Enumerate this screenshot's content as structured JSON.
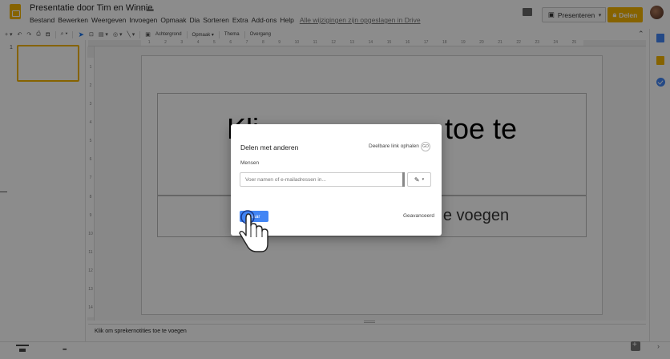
{
  "header": {
    "title": "Presentatie door Tim en Winnie",
    "menu": [
      "Bestand",
      "Bewerken",
      "Weergeven",
      "Invoegen",
      "Opmaak",
      "Dia",
      "Sorteren",
      "Extra",
      "Add-ons",
      "Help"
    ],
    "saved_status": "Alle wijzigingen zijn opgeslagen in Drive",
    "present_label": "Presenteren",
    "share_label": "Delen"
  },
  "toolbar": {
    "background_label": "Achtergrond",
    "layout_label": "Opmaak ▾",
    "theme_label": "Thema",
    "transition_label": "Overgang"
  },
  "ruler": {
    "top": [
      "1",
      "2",
      "3",
      "4",
      "5",
      "6",
      "7",
      "8",
      "9",
      "10",
      "11",
      "12",
      "13",
      "14",
      "15",
      "16",
      "17",
      "18",
      "19",
      "20",
      "21",
      "22",
      "23",
      "24",
      "25"
    ],
    "left": [
      "1",
      "2",
      "3",
      "4",
      "5",
      "6",
      "7",
      "8",
      "9",
      "10",
      "11",
      "12",
      "13",
      "14"
    ]
  },
  "filmstrip": {
    "slide_number": "1"
  },
  "slide": {
    "title_fragment_left": "Kli",
    "title_fragment_right": "toe te",
    "subtitle_fragment": "e voegen"
  },
  "notes": {
    "placeholder": "Klik om sprekernotities toe te voegen"
  },
  "dialog": {
    "title": "Delen met anderen",
    "shareable_link": "Deelbare link ophalen",
    "link_icon_text": "GO",
    "people_label": "Mensen",
    "input_placeholder": "Voer namen of e-mailadressen in...",
    "done_label": "Klaar",
    "advanced_label": "Geavanceerd"
  },
  "colors": {
    "brand": "#f4b400",
    "primary_button": "#4285f4"
  }
}
